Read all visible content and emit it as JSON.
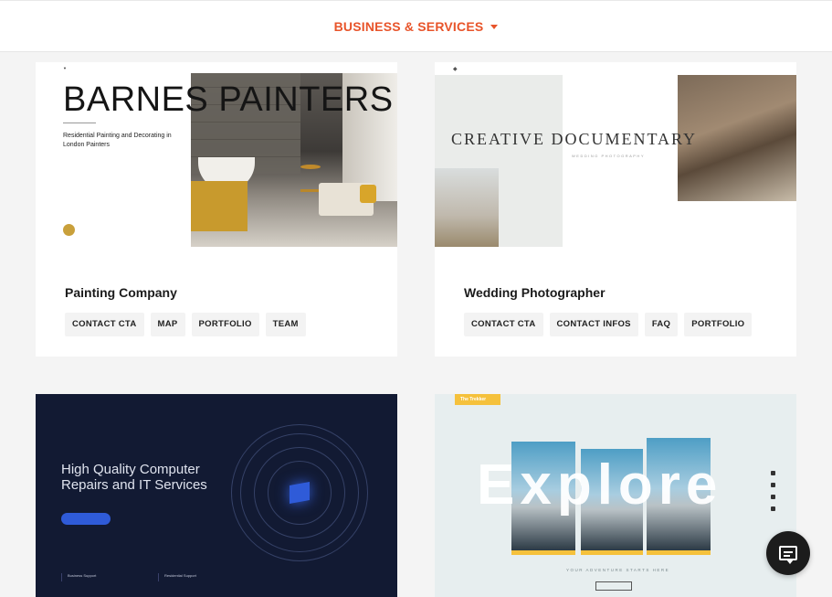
{
  "header": {
    "category_label": "BUSINESS & SERVICES"
  },
  "cards": [
    {
      "title": "Painting Company",
      "tags": [
        "CONTACT CTA",
        "MAP",
        "PORTFOLIO",
        "TEAM"
      ],
      "preview": {
        "heading": "BARNES PAINTERS",
        "subheading": "Residential Painting and Decorating in London Painters"
      }
    },
    {
      "title": "Wedding Photographer",
      "tags": [
        "CONTACT CTA",
        "CONTACT INFOS",
        "FAQ",
        "PORTFOLIO"
      ],
      "preview": {
        "heading": "CREATIVE DOCUMENTARY",
        "subheading": "WEDDING PHOTOGRAPHY"
      }
    },
    {
      "preview": {
        "heading": "High Quality Computer Repairs and IT Services",
        "col1": "Business Support",
        "col2": "Residential Support"
      }
    },
    {
      "preview": {
        "badge": "The Trekker",
        "heading": "Explore",
        "tagline": "YOUR ADVENTURE STARTS HERE"
      }
    }
  ],
  "colors": {
    "accent": "#e8542a",
    "it_bg": "#121a33",
    "explore_yellow": "#f5c13c"
  },
  "chat": {
    "icon": "chat-bubble-icon"
  }
}
